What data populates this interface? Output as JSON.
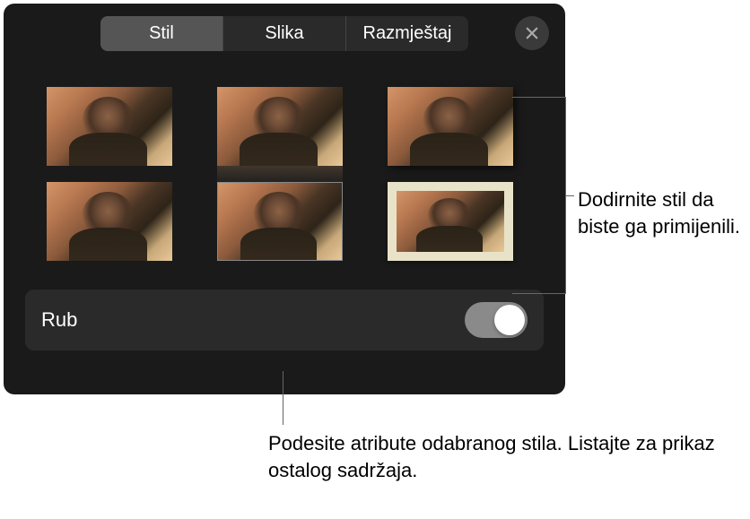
{
  "tabs": {
    "style": "Stil",
    "image": "Slika",
    "layout": "Razmještaj",
    "active": "style"
  },
  "toggle": {
    "label": "Rub",
    "value": true
  },
  "callouts": {
    "right": "Dodirnite stil da biste ga primijenili.",
    "bottom": "Podesite atribute odabranog stila. Listajte za prikaz ostalog sadržaja."
  },
  "styles": {
    "count": 6,
    "selected": 5
  }
}
